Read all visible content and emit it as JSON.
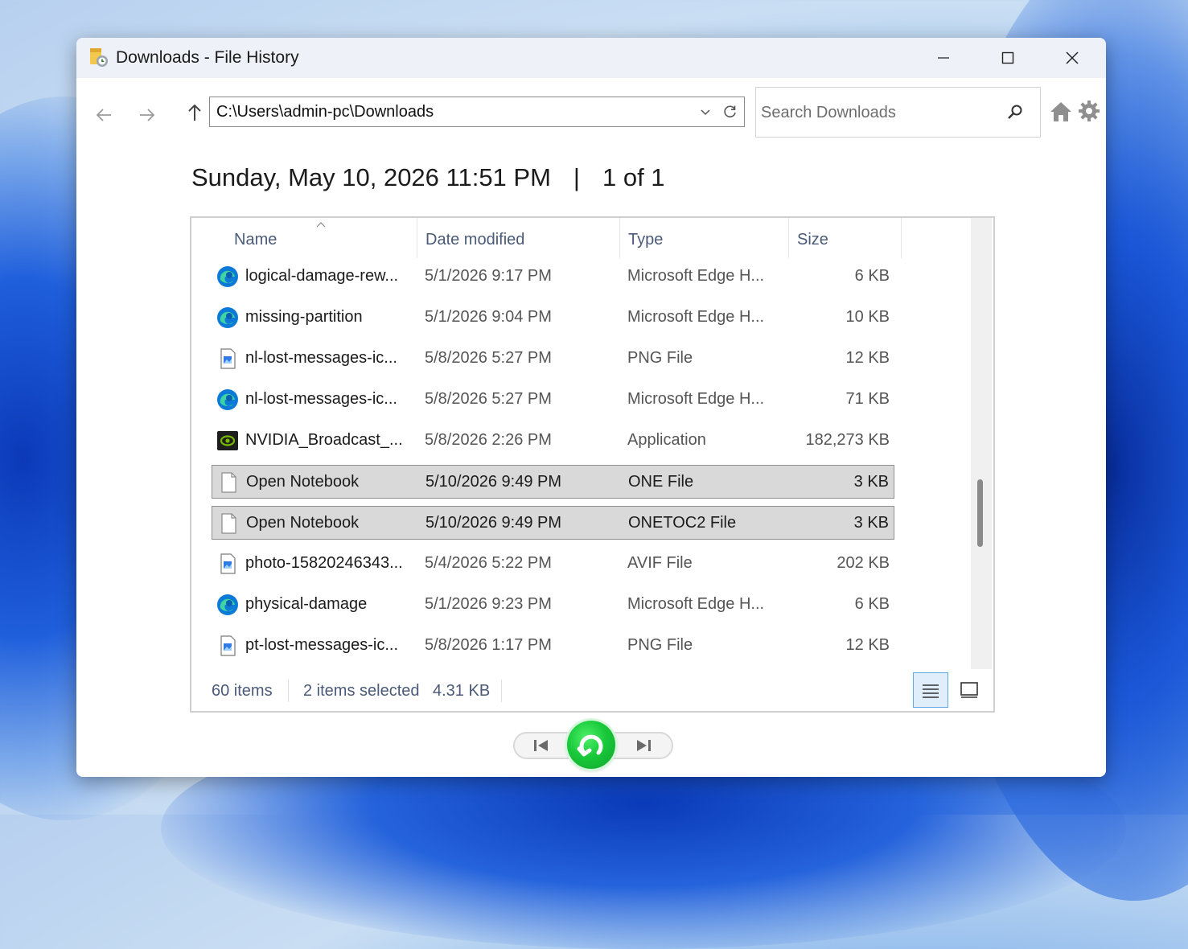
{
  "window": {
    "title": "Downloads - File History"
  },
  "toolbar": {
    "address": "C:\\Users\\admin-pc\\Downloads",
    "search_placeholder": "Search Downloads"
  },
  "header": {
    "datetime": "Sunday, May 10, 2026 11:51 PM",
    "separator": "|",
    "position": "1 of 1"
  },
  "columns": {
    "name": "Name",
    "date": "Date modified",
    "type": "Type",
    "size": "Size"
  },
  "files": [
    {
      "name": "logical-damage-rew...",
      "date": "5/1/2026 9:17 PM",
      "type": "Microsoft Edge H...",
      "size": "6 KB",
      "icon": "edge-icon",
      "selected": false
    },
    {
      "name": "missing-partition",
      "date": "5/1/2026 9:04 PM",
      "type": "Microsoft Edge H...",
      "size": "10 KB",
      "icon": "edge-icon",
      "selected": false
    },
    {
      "name": "nl-lost-messages-ic...",
      "date": "5/8/2026 5:27 PM",
      "type": "PNG File",
      "size": "12 KB",
      "icon": "image-file-icon",
      "selected": false
    },
    {
      "name": "nl-lost-messages-ic...",
      "date": "5/8/2026 5:27 PM",
      "type": "Microsoft Edge H...",
      "size": "71 KB",
      "icon": "edge-icon",
      "selected": false
    },
    {
      "name": "NVIDIA_Broadcast_...",
      "date": "5/8/2026 2:26 PM",
      "type": "Application",
      "size": "182,273 KB",
      "icon": "nvidia-icon",
      "selected": false
    },
    {
      "name": "Open Notebook",
      "date": "5/10/2026 9:49 PM",
      "type": "ONE File",
      "size": "3 KB",
      "icon": "blank-file-icon",
      "selected": true
    },
    {
      "name": "Open Notebook",
      "date": "5/10/2026 9:49 PM",
      "type": "ONETOC2 File",
      "size": "3 KB",
      "icon": "blank-file-icon",
      "selected": true
    },
    {
      "name": "photo-15820246343...",
      "date": "5/4/2026 5:22 PM",
      "type": "AVIF File",
      "size": "202 KB",
      "icon": "image-file-icon",
      "selected": false
    },
    {
      "name": "physical-damage",
      "date": "5/1/2026 9:23 PM",
      "type": "Microsoft Edge H...",
      "size": "6 KB",
      "icon": "edge-icon",
      "selected": false
    },
    {
      "name": "pt-lost-messages-ic...",
      "date": "5/8/2026 1:17 PM",
      "type": "PNG File",
      "size": "12 KB",
      "icon": "image-file-icon",
      "selected": false
    }
  ],
  "status": {
    "items": "60 items",
    "selected": "2 items selected",
    "selected_size": "4.31 KB"
  },
  "colors": {
    "selection_bg": "#d9d9d9",
    "restore_green": "#19c93a",
    "header_text": "#4a5a78"
  }
}
